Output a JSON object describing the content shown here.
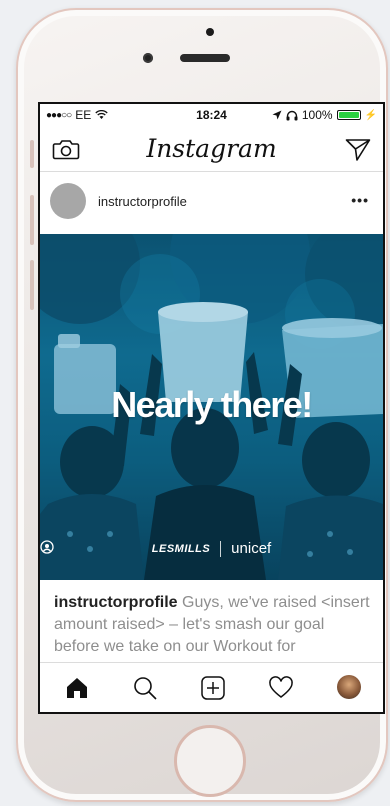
{
  "status_bar": {
    "carrier": "EE",
    "signal": "●●●○○",
    "time": "18:24",
    "battery": "100%",
    "battery_level": 1.0
  },
  "header": {
    "logo_text": "Instagram",
    "left_icon": "camera-icon",
    "right_icon": "direct-send-icon"
  },
  "post": {
    "username": "instructorprofile",
    "more": "•••",
    "image": {
      "headline": "Nearly there!",
      "brand_left": "LESMILLS",
      "brand_right": "unicef"
    },
    "caption_user": "instructorprofile",
    "caption_text": " Guys, we've raised <insert amount raised> – let's smash our goal before we take on our Workout for"
  },
  "tab_bar": {
    "items": [
      "home-icon",
      "search-icon",
      "new-post-icon",
      "activity-heart-icon",
      "profile-avatar"
    ]
  },
  "colors": {
    "accent_battery": "#2bd141",
    "image_tint": "#0f6a8e",
    "rose_gold": "#e3c7bf"
  }
}
